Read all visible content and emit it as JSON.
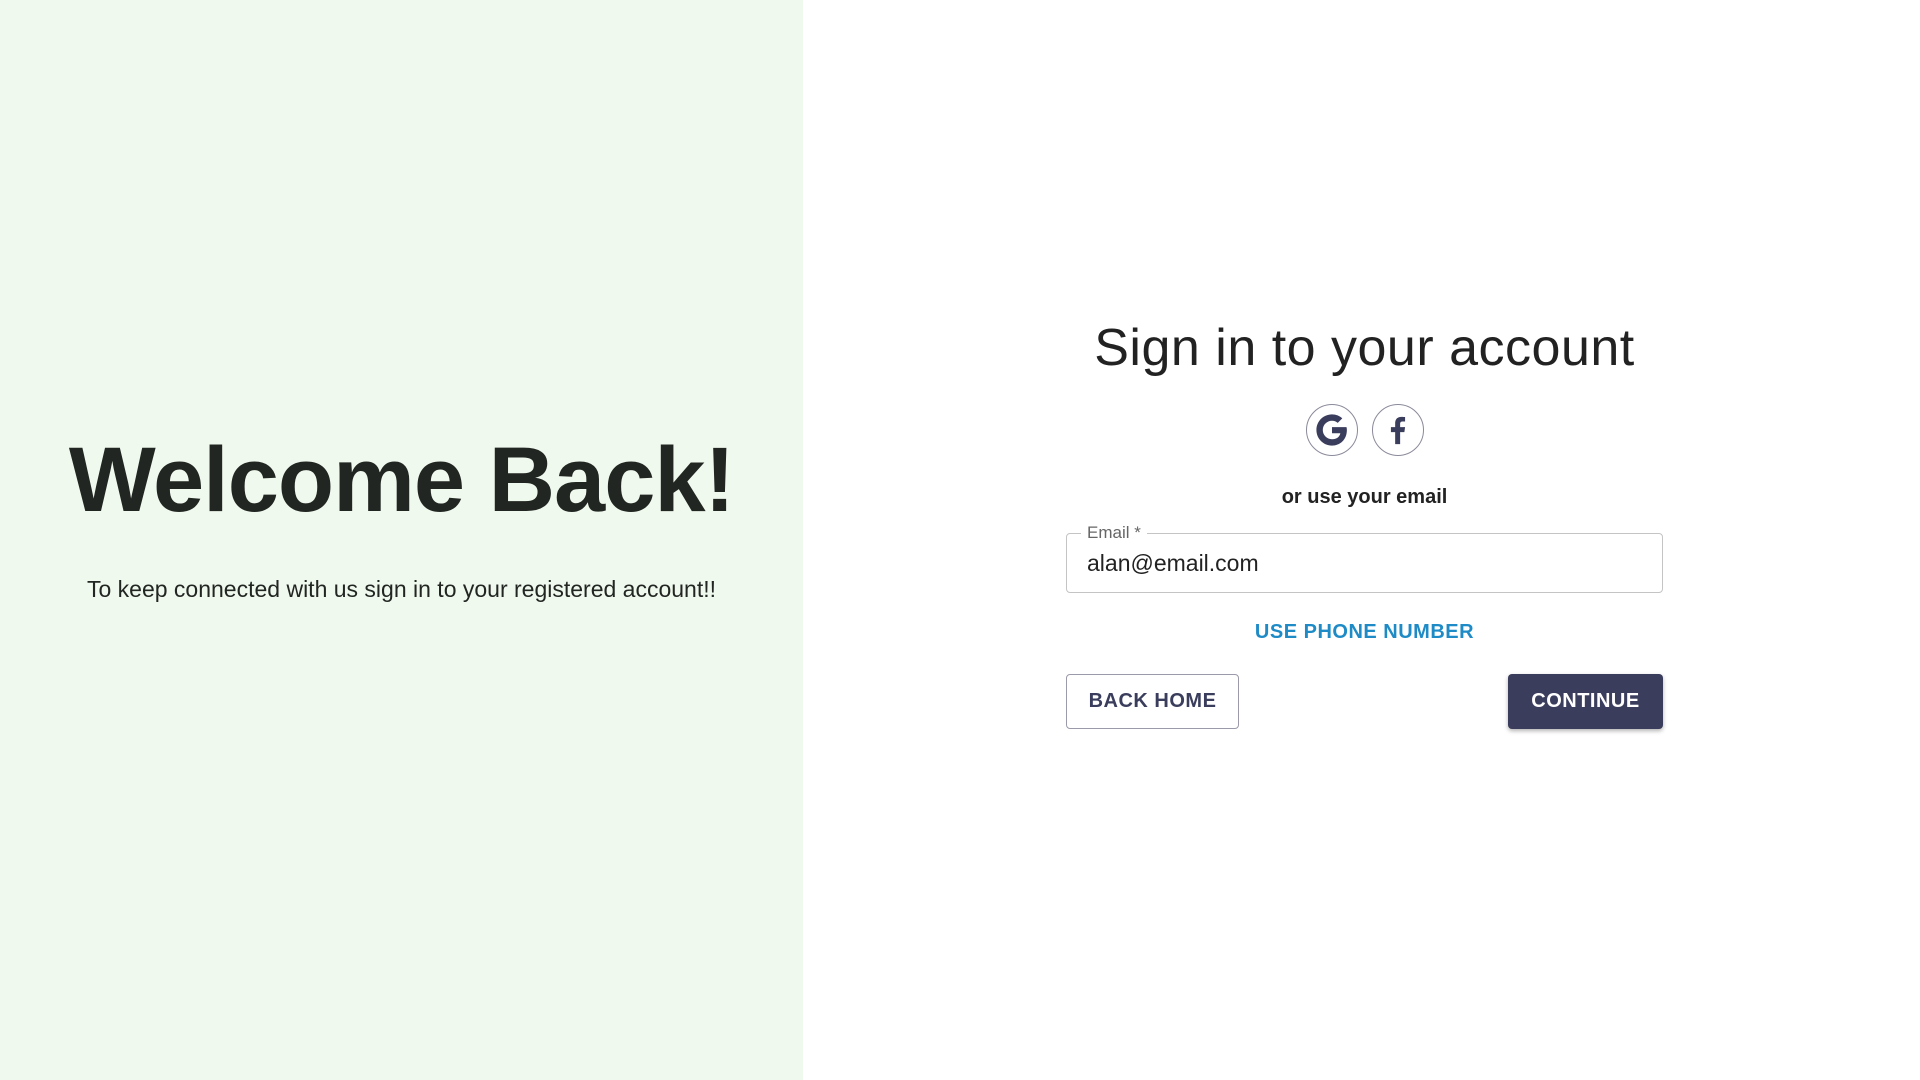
{
  "colors": {
    "left_panel_bg": "#f0f9ee",
    "primary": "#3a3d5c",
    "link": "#1f8bc6"
  },
  "welcome": {
    "title": "Welcome Back!",
    "subtitle": "To keep connected with us sign in to your registered account!!"
  },
  "signin": {
    "title": "Sign in to your account",
    "social": [
      {
        "icon": "google-icon",
        "name": "Google"
      },
      {
        "icon": "facebook-icon",
        "name": "Facebook"
      }
    ],
    "divider_text": "or use your email",
    "email": {
      "label": "Email *",
      "value": "alan@email.com"
    },
    "use_phone_label": "USE PHONE NUMBER",
    "back_home_label": "BACK HOME",
    "continue_label": "CONTINUE"
  }
}
